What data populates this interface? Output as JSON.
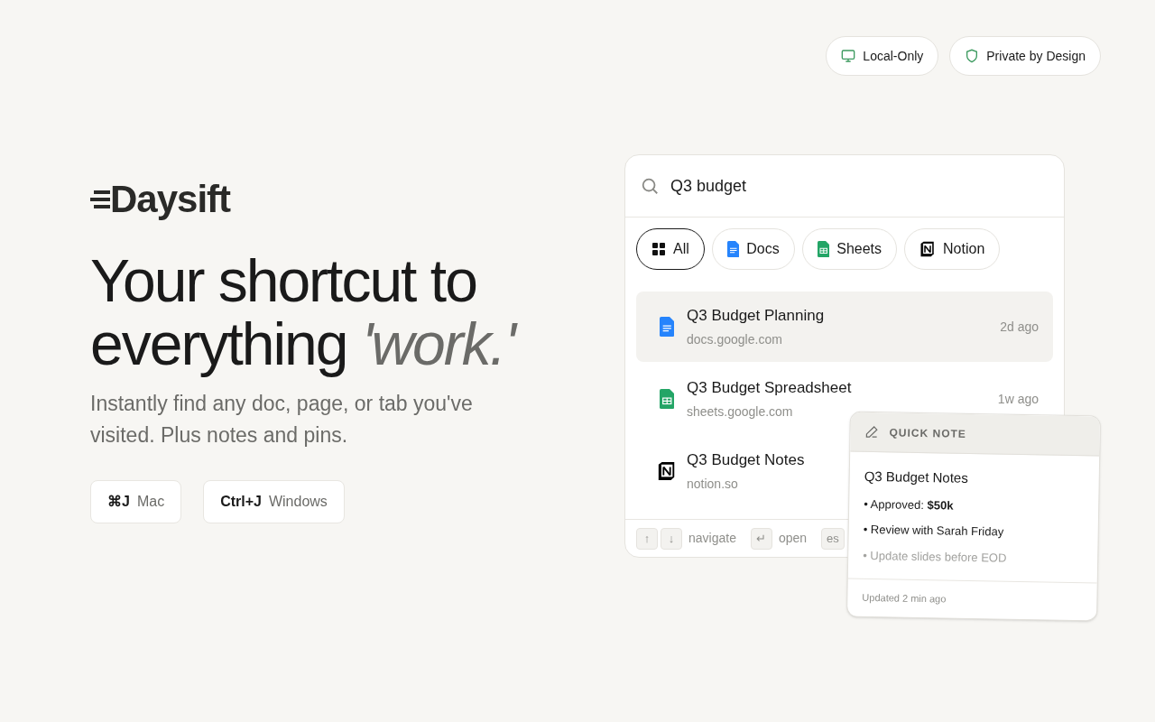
{
  "badges": [
    {
      "kind": "monitor",
      "label": "Local-Only"
    },
    {
      "kind": "shield",
      "label": "Private by Design"
    }
  ],
  "logo": "Daysift",
  "headline": "Your shortcut to everything",
  "headline_emphasis": "'work.'",
  "subtitle": "Instantly find any doc, page, or tab you've visited. Plus notes and pins.",
  "shortcuts": [
    {
      "keys": "⌘J",
      "platform": "Mac"
    },
    {
      "keys": "Ctrl+J",
      "platform": "Windows"
    }
  ],
  "search": {
    "value": "Q3 budget"
  },
  "filters": [
    {
      "kind": "all",
      "label": "All",
      "selected": true
    },
    {
      "kind": "docs",
      "label": "Docs",
      "selected": false
    },
    {
      "kind": "sheets",
      "label": "Sheets",
      "selected": false
    },
    {
      "kind": "notion",
      "label": "Notion",
      "selected": false
    }
  ],
  "results": [
    {
      "kind": "docs",
      "title": "Q3 Budget Planning",
      "url": "docs.google.com",
      "time": "2d ago",
      "selected": true
    },
    {
      "kind": "sheets",
      "title": "Q3 Budget Spreadsheet",
      "url": "sheets.google.com",
      "time": "1w ago",
      "selected": false
    },
    {
      "kind": "notion",
      "title": "Q3 Budget Notes",
      "url": "notion.so",
      "selected": false
    }
  ],
  "footer_hints": [
    {
      "keys": [
        "↑",
        "↓"
      ],
      "label": "navigate"
    },
    {
      "keys": [
        "↵"
      ],
      "label": "open"
    },
    {
      "keys": [
        "es"
      ]
    }
  ],
  "quick_note": {
    "header": "QUICK NOTE",
    "title": "Q3 Budget Notes",
    "items": [
      {
        "text": "• Approved: **$50k**",
        "done": false
      },
      {
        "text": "• Review with Sarah Friday",
        "done": false
      },
      {
        "text": "• Update slides before EOD",
        "done": true
      }
    ],
    "updated": "Updated 2 min ago"
  }
}
